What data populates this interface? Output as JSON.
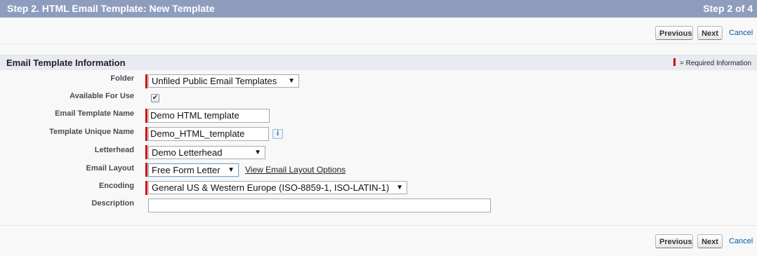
{
  "header": {
    "title": "Step 2. HTML Email Template: New Template",
    "step": "Step 2 of 4"
  },
  "buttons": {
    "previous": "Previous",
    "next": "Next",
    "cancel": "Cancel"
  },
  "section": {
    "title": "Email Template Information",
    "required_legend": "= Required Information"
  },
  "form": {
    "folder": {
      "label": "Folder",
      "value": "Unfiled Public Email Templates"
    },
    "available": {
      "label": "Available For Use",
      "checked": true,
      "check_glyph": "✔"
    },
    "template_name": {
      "label": "Email Template Name",
      "value": "Demo HTML template"
    },
    "unique_name": {
      "label": "Template Unique Name",
      "value": "Demo_HTML_template",
      "info_glyph": "i"
    },
    "letterhead": {
      "label": "Letterhead",
      "value": "Demo Letterhead"
    },
    "email_layout": {
      "label": "Email Layout",
      "value": "Free Form Letter",
      "link": "View Email Layout Options"
    },
    "encoding": {
      "label": "Encoding",
      "value": "General US & Western Europe (ISO-8859-1, ISO-LATIN-1)"
    },
    "description": {
      "label": "Description",
      "value": ""
    }
  },
  "icons": {
    "dropdown_arrow": "▼"
  },
  "colors": {
    "header_bg": "#8e9dbe",
    "required": "#cc0000",
    "link": "#015ba7"
  }
}
